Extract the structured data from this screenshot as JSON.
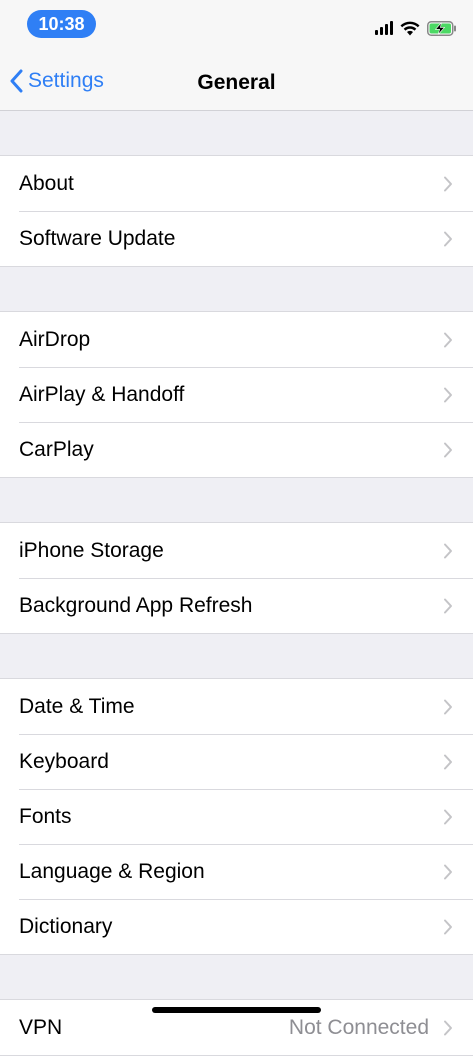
{
  "status_bar": {
    "time": "10:38",
    "time_pill_color": "#2f7ff5",
    "icons": [
      "signal-icon",
      "wifi-icon",
      "battery-charging-icon"
    ]
  },
  "nav": {
    "back_label": "Settings",
    "title": "General",
    "accent_color": "#2f7ff5"
  },
  "groups": [
    {
      "rows": [
        {
          "label": "About"
        },
        {
          "label": "Software Update"
        }
      ]
    },
    {
      "rows": [
        {
          "label": "AirDrop"
        },
        {
          "label": "AirPlay & Handoff"
        },
        {
          "label": "CarPlay"
        }
      ]
    },
    {
      "rows": [
        {
          "label": "iPhone Storage"
        },
        {
          "label": "Background App Refresh"
        }
      ]
    },
    {
      "rows": [
        {
          "label": "Date & Time"
        },
        {
          "label": "Keyboard"
        },
        {
          "label": "Fonts"
        },
        {
          "label": "Language & Region"
        },
        {
          "label": "Dictionary"
        }
      ]
    },
    {
      "rows": [
        {
          "label": "VPN",
          "value": "Not Connected"
        }
      ]
    }
  ]
}
